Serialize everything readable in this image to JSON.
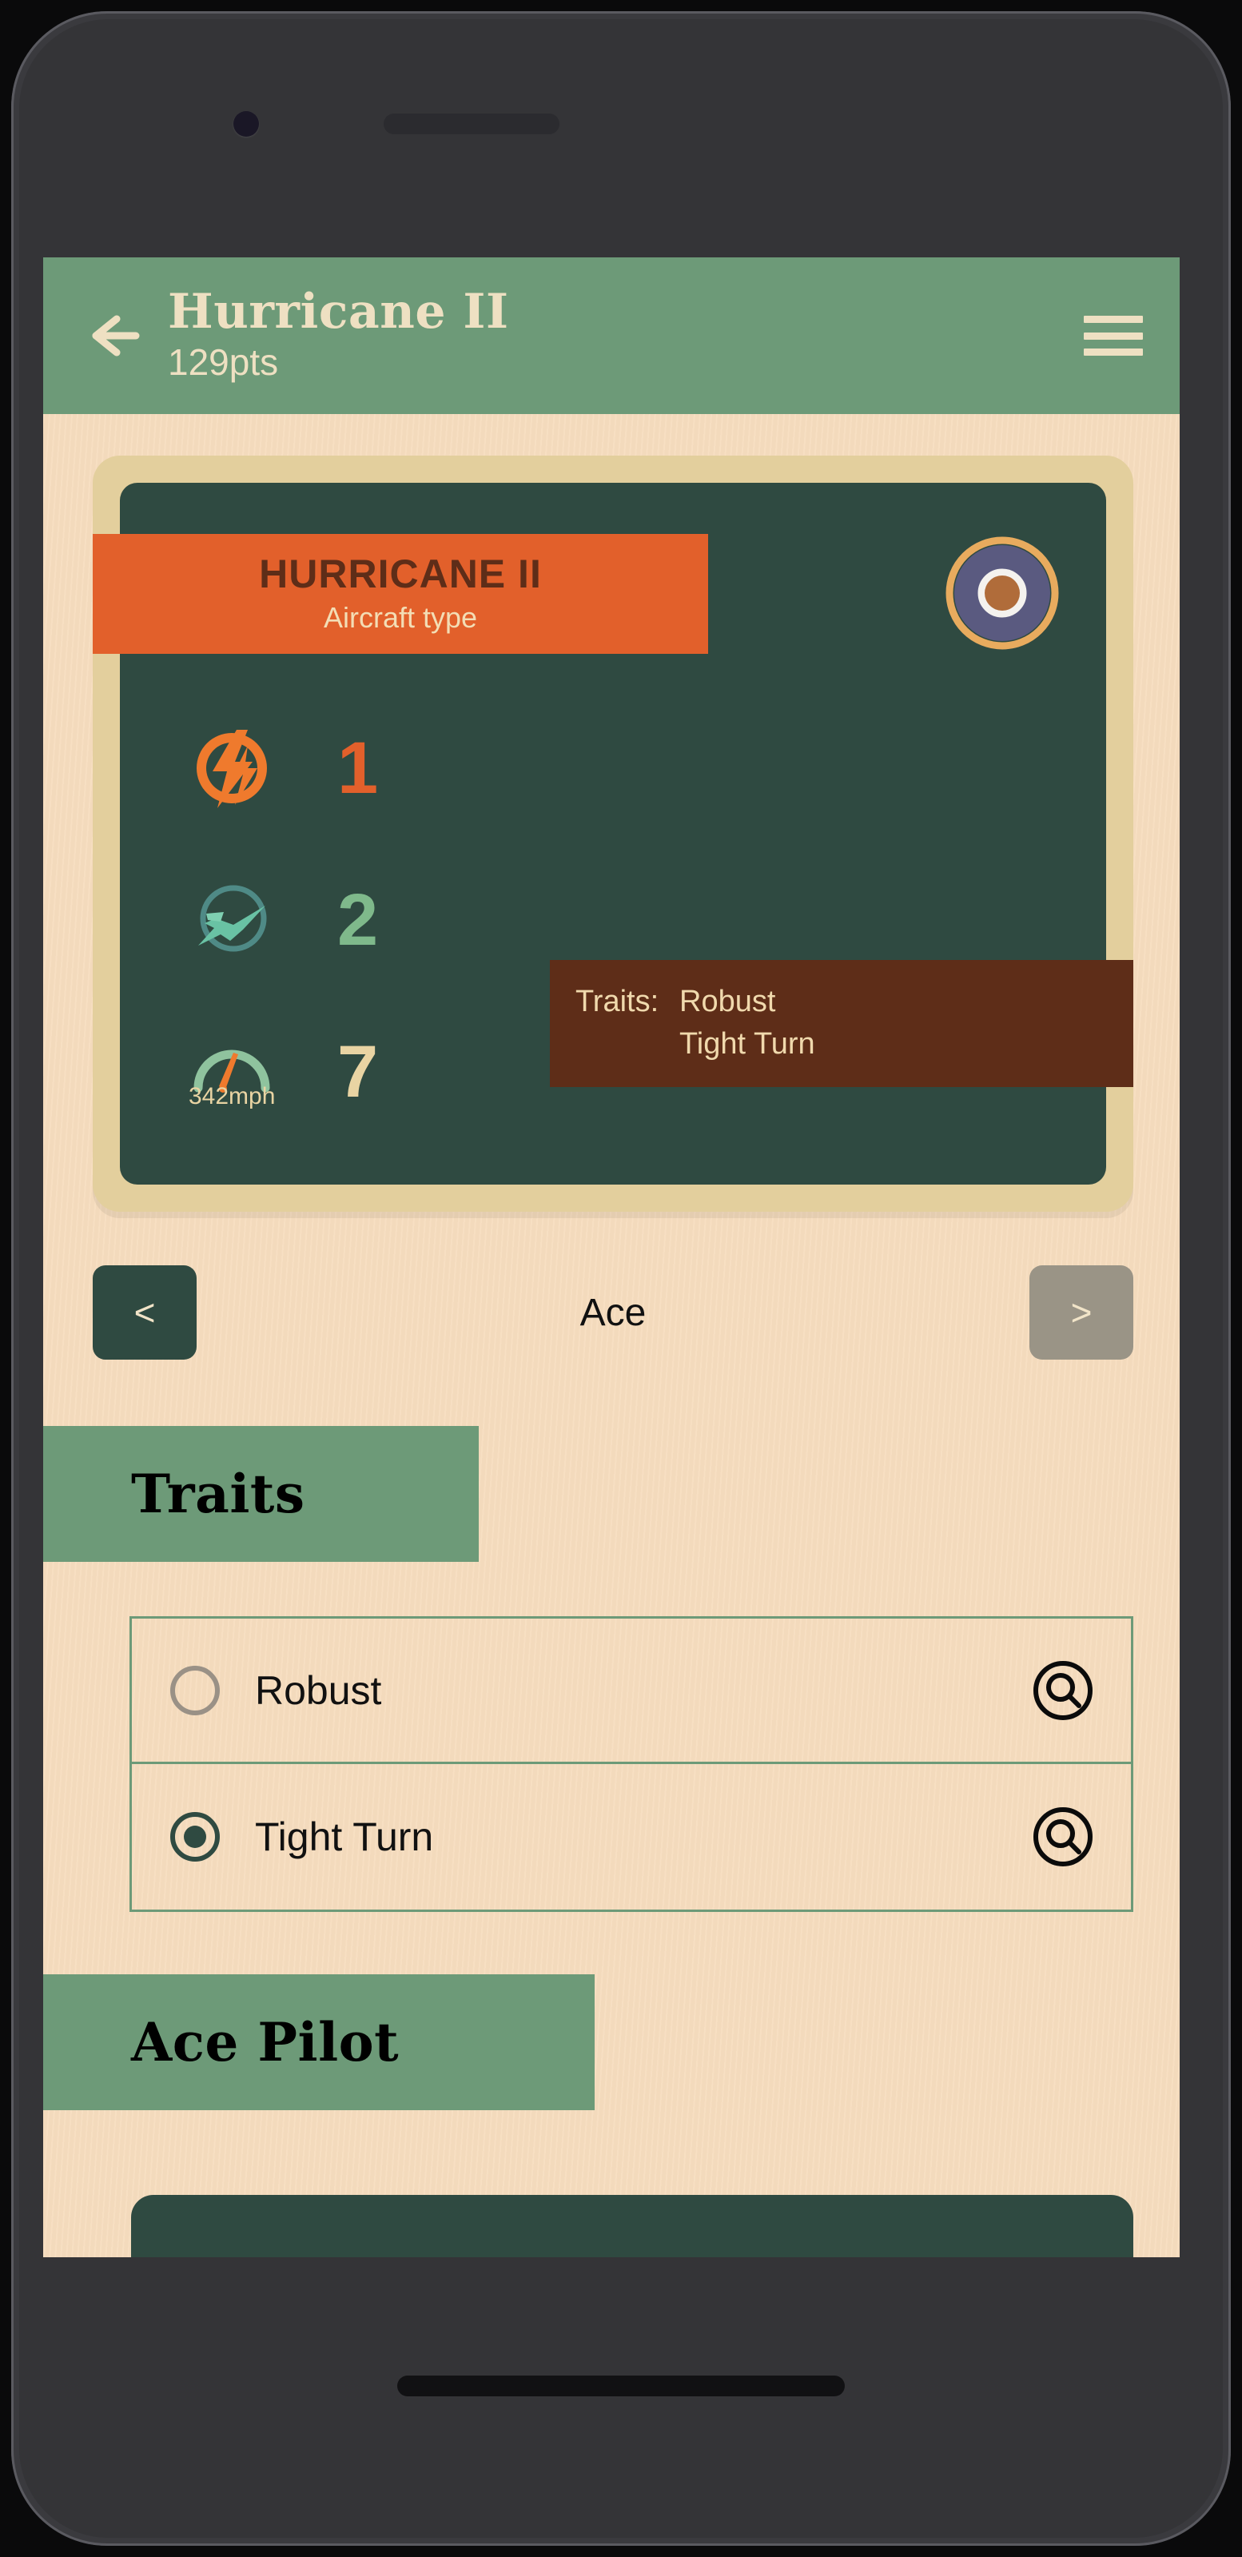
{
  "app": {
    "header": {
      "back_icon": "back-arrow-icon",
      "title": "Hurricane II",
      "points": "129pts",
      "menu_icon": "hamburger-menu-icon"
    }
  },
  "aircraft_card": {
    "type_name": "HURRICANE II",
    "type_label": "Aircraft type",
    "roundel_icon": "raf-roundel-icon",
    "stats": [
      {
        "icon": "firepower-lightning-icon",
        "name": "firepower",
        "value": "1",
        "sublabel": ""
      },
      {
        "icon": "agility-airplane-icon",
        "name": "agility",
        "value": "2",
        "sublabel": ""
      },
      {
        "icon": "speed-gauge-icon",
        "name": "speed",
        "value": "7",
        "sublabel": "342mph"
      }
    ],
    "traits_tooltip": {
      "key": "Traits:",
      "values": [
        "Robust",
        "Tight Turn"
      ]
    }
  },
  "pager": {
    "prev_label": "<",
    "current_label": "Ace",
    "next_label": ">"
  },
  "sections": {
    "traits": {
      "heading": "Traits",
      "items": [
        {
          "label": "Robust",
          "selected": false,
          "action_icon": "search-icon"
        },
        {
          "label": "Tight Turn",
          "selected": true,
          "action_icon": "search-icon"
        }
      ]
    },
    "ace_pilot": {
      "heading": "Ace Pilot"
    }
  },
  "colors": {
    "header_green": "#6d9a78",
    "paper": "#f7ddbf",
    "dark_green": "#2f4a41",
    "orange": "#e2602b",
    "brown": "#5e2d18",
    "cream": "#eee0c2",
    "tan_frame": "#e3cf9d",
    "grey_disabled": "#9a9486"
  }
}
